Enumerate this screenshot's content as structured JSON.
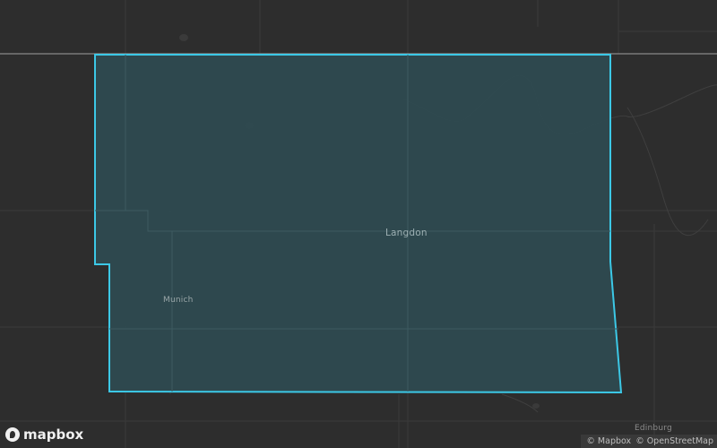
{
  "map": {
    "places": [
      {
        "id": "langdon",
        "name": "Langdon"
      },
      {
        "id": "munich",
        "name": "Munich"
      },
      {
        "id": "edinburg",
        "name": "Edinburg"
      }
    ],
    "region_fill": "#2e4a50",
    "region_stroke": "#3cc8e6"
  },
  "branding": {
    "logo_text": "mapbox"
  },
  "attribution": {
    "mapbox": "© Mapbox",
    "osm": "© OpenStreetMap"
  }
}
